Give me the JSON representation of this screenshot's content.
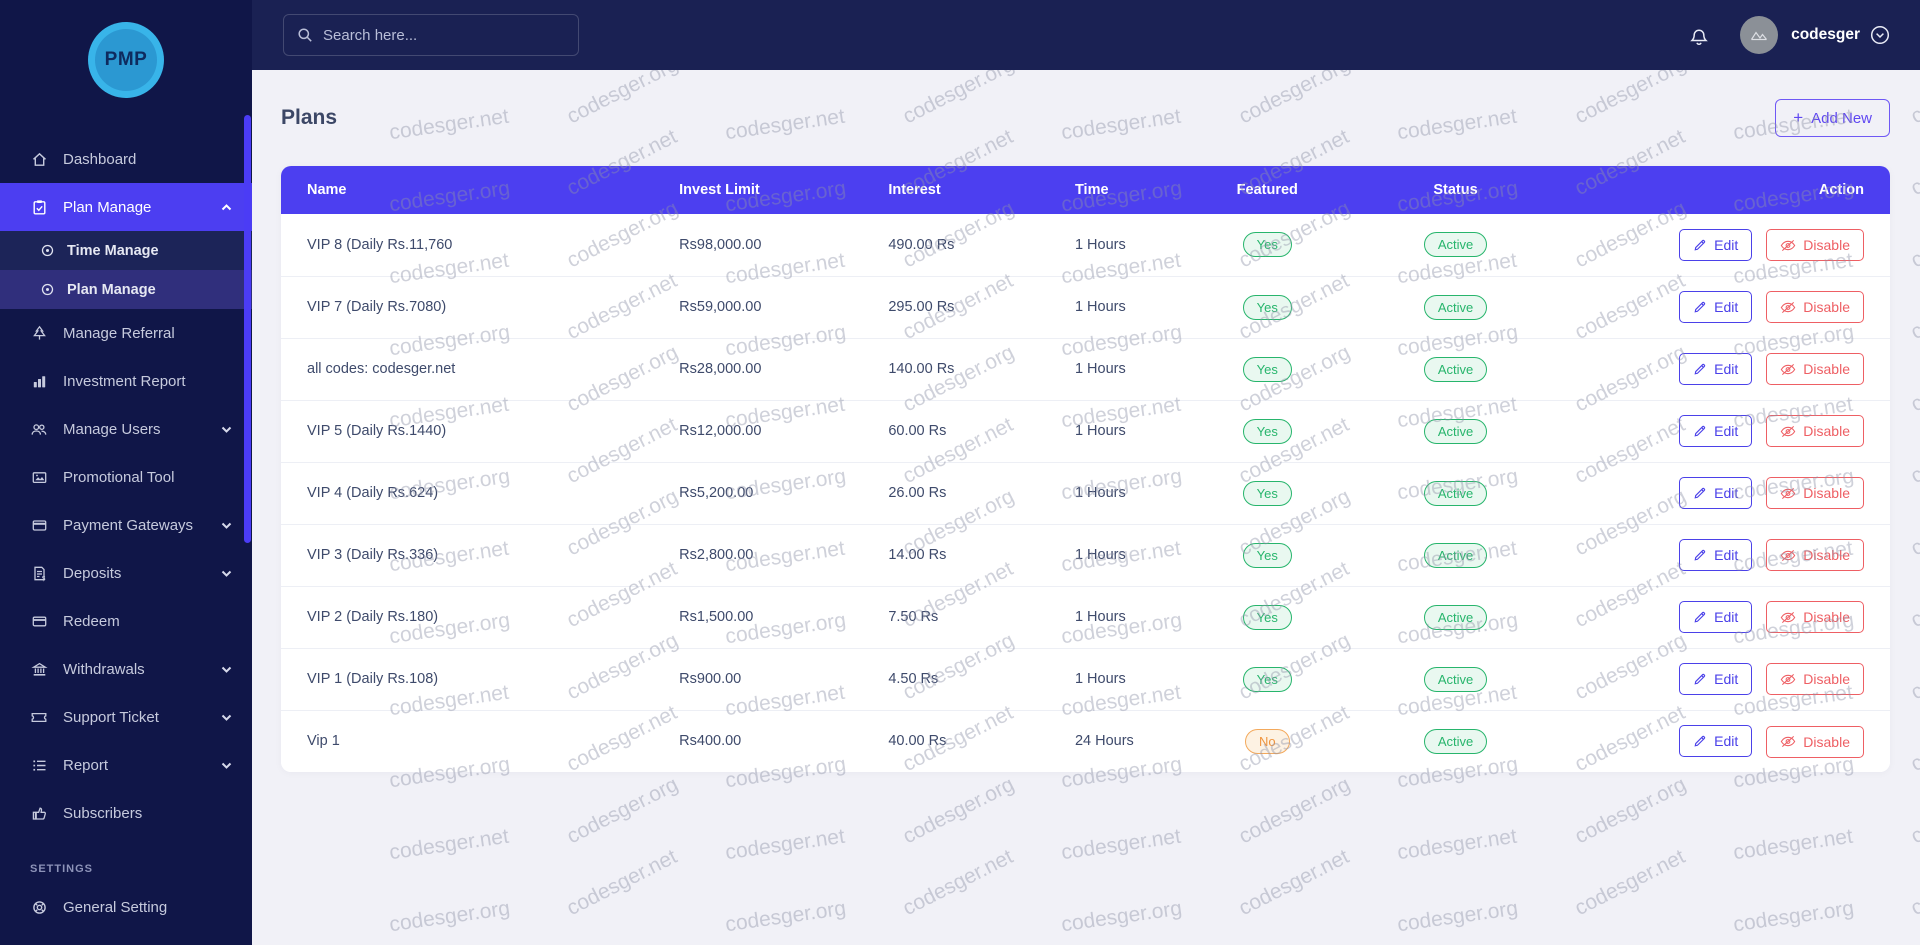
{
  "sidebar": {
    "logo_text": "PMP",
    "items": [
      {
        "label": "Dashboard"
      },
      {
        "label": "Plan Manage"
      },
      {
        "label": "Time Manage"
      },
      {
        "label": "Plan Manage"
      },
      {
        "label": "Manage Referral"
      },
      {
        "label": "Investment Report"
      },
      {
        "label": "Manage Users"
      },
      {
        "label": "Promotional Tool"
      },
      {
        "label": "Payment Gateways"
      },
      {
        "label": "Deposits"
      },
      {
        "label": "Redeem"
      },
      {
        "label": "Withdrawals"
      },
      {
        "label": "Support Ticket"
      },
      {
        "label": "Report"
      },
      {
        "label": "Subscribers"
      }
    ],
    "section_label": "SETTINGS",
    "settings_items": [
      {
        "label": "General Setting"
      }
    ]
  },
  "topbar": {
    "search_placeholder": "Search here...",
    "username": "codesger"
  },
  "page": {
    "title": "Plans",
    "add_new_plus": "+",
    "add_new_label": "Add New"
  },
  "table": {
    "columns": [
      "Name",
      "Invest Limit",
      "Interest",
      "Time",
      "Featured",
      "Status",
      "Action"
    ],
    "edit_label": "Edit",
    "disable_label": "Disable",
    "rows": [
      {
        "name": "VIP 8 (Daily Rs.11,760",
        "invest_limit": "Rs98,000.00",
        "interest": "490.00 Rs",
        "time": "1 Hours",
        "featured": "Yes",
        "status": "Active"
      },
      {
        "name": "VIP 7 (Daily Rs.7080)",
        "invest_limit": "Rs59,000.00",
        "interest": "295.00 Rs",
        "time": "1 Hours",
        "featured": "Yes",
        "status": "Active"
      },
      {
        "name": "all codes: codesger.net",
        "invest_limit": "Rs28,000.00",
        "interest": "140.00 Rs",
        "time": "1 Hours",
        "featured": "Yes",
        "status": "Active"
      },
      {
        "name": "VIP 5 (Daily Rs.1440)",
        "invest_limit": "Rs12,000.00",
        "interest": "60.00 Rs",
        "time": "1 Hours",
        "featured": "Yes",
        "status": "Active"
      },
      {
        "name": "VIP 4 (Daily Rs.624)",
        "invest_limit": "Rs5,200.00",
        "interest": "26.00 Rs",
        "time": "1 Hours",
        "featured": "Yes",
        "status": "Active"
      },
      {
        "name": "VIP 3 (Daily Rs.336)",
        "invest_limit": "Rs2,800.00",
        "interest": "14.00 Rs",
        "time": "1 Hours",
        "featured": "Yes",
        "status": "Active"
      },
      {
        "name": "VIP 2 (Daily Rs.180)",
        "invest_limit": "Rs1,500.00",
        "interest": "7.50 Rs",
        "time": "1 Hours",
        "featured": "Yes",
        "status": "Active"
      },
      {
        "name": "VIP 1 (Daily Rs.108)",
        "invest_limit": "Rs900.00",
        "interest": "4.50 Rs",
        "time": "1 Hours",
        "featured": "Yes",
        "status": "Active"
      },
      {
        "name": "Vip 1",
        "invest_limit": "Rs400.00",
        "interest": "40.00 Rs",
        "time": "24 Hours",
        "featured": "No",
        "status": "Active"
      }
    ]
  },
  "watermark": {
    "org": "codesger.org",
    "net": "codesger.net"
  },
  "colors": {
    "accent": "#4c3ff0",
    "sidebar_bg": "#101648",
    "topbar_bg": "#1a2153",
    "green": "#27b56c",
    "orange": "#f0943d",
    "red": "#ee5f64",
    "logo_blue": "#38b4e9"
  }
}
